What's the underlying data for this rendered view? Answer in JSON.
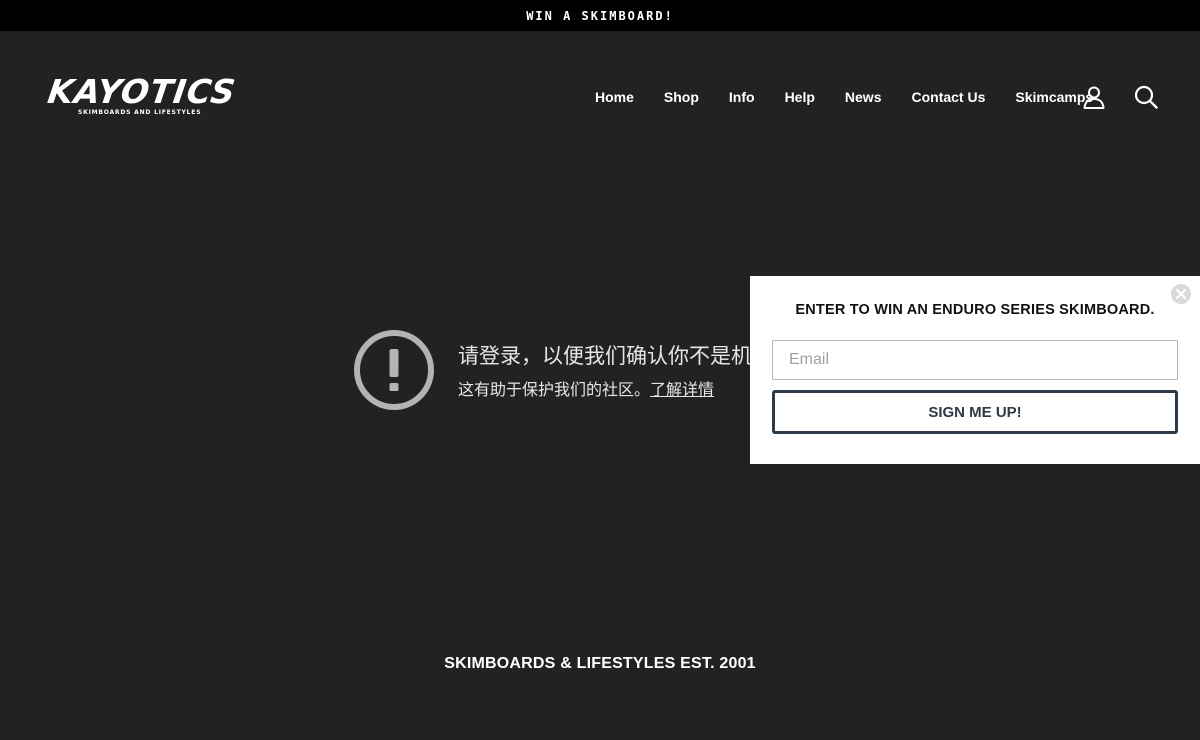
{
  "announcement": {
    "text": "WIN A SKIMBOARD!"
  },
  "header": {
    "logo": {
      "word": "KAYOTICS",
      "tagline": "SKIMBOARDS AND LIFESTYLES"
    },
    "nav": [
      {
        "label": "Home"
      },
      {
        "label": "Shop"
      },
      {
        "label": "Info"
      },
      {
        "label": "Help"
      },
      {
        "label": "News"
      },
      {
        "label": "Contact Us"
      },
      {
        "label": "Skimcamps"
      }
    ],
    "icons": {
      "account": "user-icon",
      "search": "search-icon"
    }
  },
  "main": {
    "icon": "exclamation-circle-icon",
    "title": "请登录，以便我们确认你不是机器人",
    "subtitle": "这有助于保护我们的社区。",
    "link": "了解详情"
  },
  "footer": {
    "tagline": "SKIMBOARDS & LIFESTYLES EST. 2001"
  },
  "popup": {
    "title": "ENTER TO WIN AN ENDURO SERIES SKIMBOARD.",
    "email_placeholder": "Email",
    "email_value": "",
    "submit_label": "SIGN ME UP!",
    "close_icon": "close-icon"
  },
  "colors": {
    "page_bg": "#222222",
    "announce_bg": "#000000",
    "popup_bg": "#ffffff",
    "button_border": "#2c3b47",
    "icon_gray": "#b3b3b3"
  }
}
